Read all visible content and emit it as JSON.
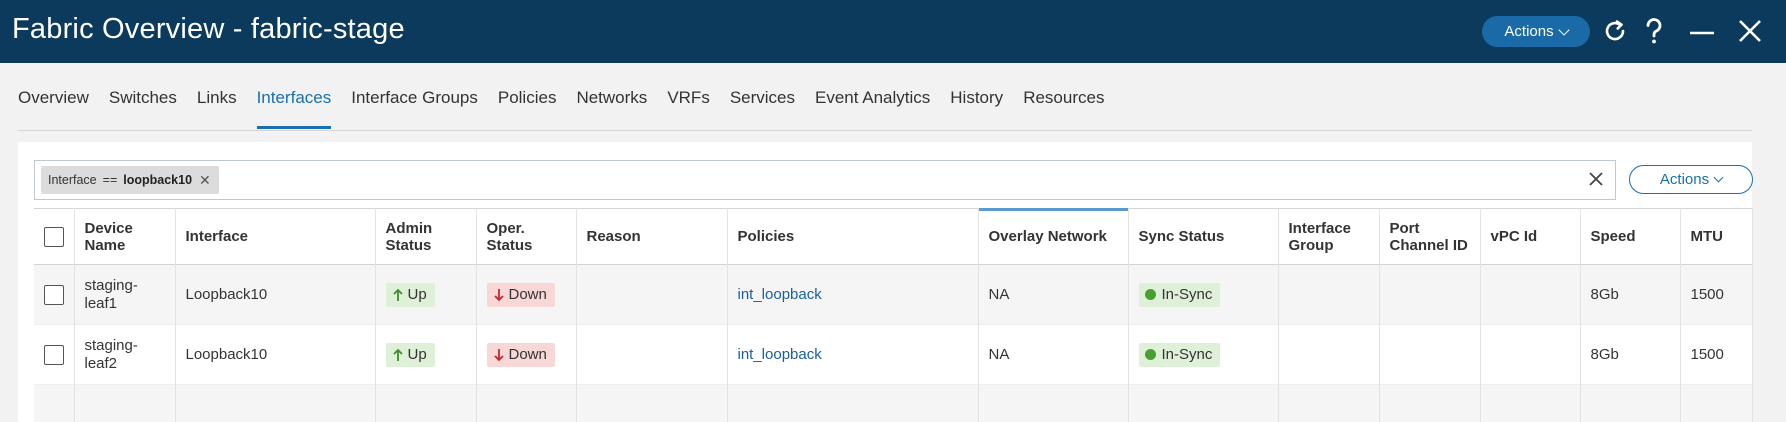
{
  "window": {
    "title": "Fabric Overview - fabric-stage",
    "actions_label": "Actions"
  },
  "header_icons": [
    "refresh-icon",
    "help-icon",
    "minimize-icon",
    "close-icon"
  ],
  "tabs": [
    {
      "label": "Overview"
    },
    {
      "label": "Switches"
    },
    {
      "label": "Links"
    },
    {
      "label": "Interfaces",
      "active": true
    },
    {
      "label": "Interface Groups"
    },
    {
      "label": "Policies"
    },
    {
      "label": "Networks"
    },
    {
      "label": "VRFs"
    },
    {
      "label": "Services"
    },
    {
      "label": "Event Analytics"
    },
    {
      "label": "History"
    },
    {
      "label": "Resources"
    }
  ],
  "filter": {
    "field": "Interface",
    "operator": "==",
    "value": "loopback10"
  },
  "panel": {
    "actions_label": "Actions"
  },
  "table": {
    "columns": [
      "Device Name",
      "Interface",
      "Admin Status",
      "Oper. Status",
      "Reason",
      "Policies",
      "Overlay Network",
      "Sync Status",
      "Interface Group",
      "Port Channel ID",
      "vPC Id",
      "Speed",
      "MTU"
    ],
    "sorted_column": "Overlay Network",
    "rows": [
      {
        "device": "staging-leaf1",
        "interface": "Loopback10",
        "admin": "Up",
        "oper": "Down",
        "reason": "",
        "policy": "int_loopback",
        "overlay": "NA",
        "sync": "In-Sync",
        "group": "",
        "port_channel": "",
        "vpc": "",
        "speed": "8Gb",
        "mtu": "1500"
      },
      {
        "device": "staging-leaf2",
        "interface": "Loopback10",
        "admin": "Up",
        "oper": "Down",
        "reason": "",
        "policy": "int_loopback",
        "overlay": "NA",
        "sync": "In-Sync",
        "group": "",
        "port_channel": "",
        "vpc": "",
        "speed": "8Gb",
        "mtu": "1500"
      }
    ]
  },
  "colors": {
    "header_bg": "#0b3a5c",
    "accent": "#1a6fb0",
    "up_bg": "#dff0d8",
    "down_bg": "#f8d7d7",
    "sync_dot": "#46a12f"
  }
}
